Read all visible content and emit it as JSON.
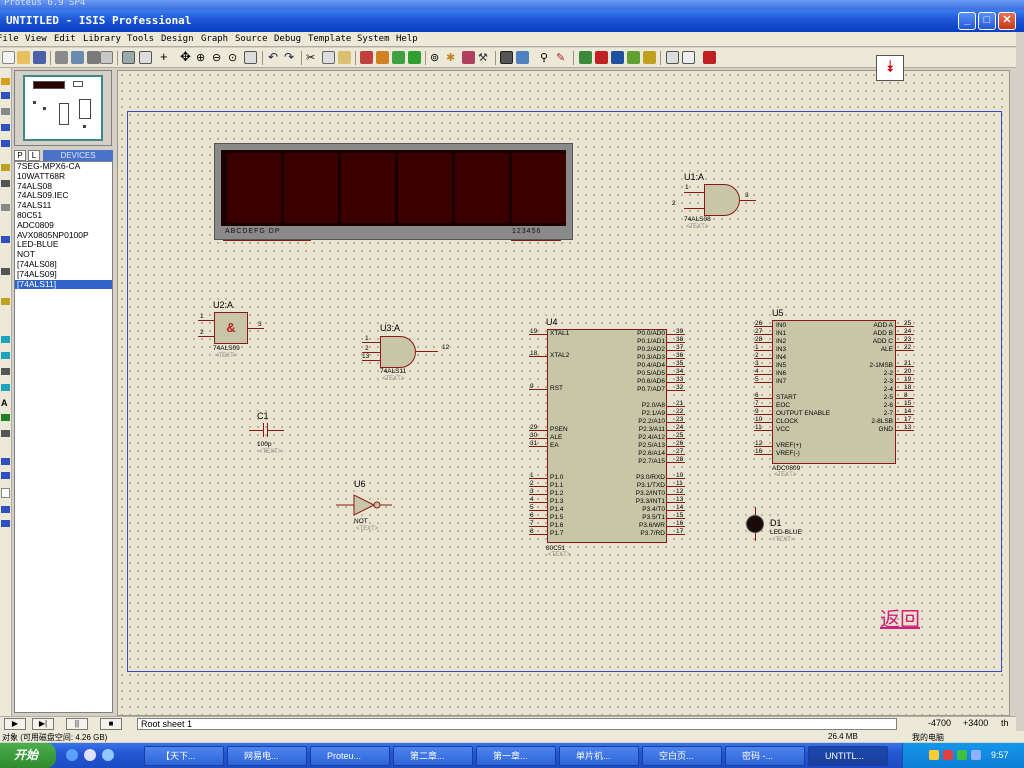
{
  "window": {
    "title": "UNTITLED - ISIS Professional",
    "ghost_title": "Proteus 6.9 SP4"
  },
  "menu": [
    "File",
    "View",
    "Edit",
    "Library",
    "Tools",
    "Design",
    "Graph",
    "Source",
    "Debug",
    "Template",
    "System",
    "Help"
  ],
  "devices": {
    "tab_p": "P",
    "tab_l": "L",
    "title": "DEVICES",
    "items": [
      "7SEG-MPX6-CA",
      "10WATT68R",
      "74ALS08",
      "74ALS09.IEC",
      "74ALS11",
      "80C51",
      "ADC0809",
      "AVX0805NP0100P",
      "LED-BLUE",
      "NOT",
      "[74ALS08]",
      "[74ALS09]",
      "[74ALS11]"
    ],
    "selected_index": 12
  },
  "canvas": {
    "back_link": "返回",
    "display": {
      "labels_left": "ABCDEFG DP",
      "labels_right": "123456"
    },
    "u1": {
      "ref": "U1:A",
      "part": "74ALS08",
      "text": "<TEXT>",
      "pins": [
        "1",
        "2",
        "3"
      ]
    },
    "u2": {
      "ref": "U2:A",
      "part": "74ALS09",
      "text": "<TEXT>",
      "symbol": "&",
      "pins": [
        "1",
        "2",
        "3"
      ]
    },
    "u3": {
      "ref": "U3:A",
      "part": "74ALS11",
      "text": "<TEXT>",
      "pins": [
        "1",
        "2",
        "13",
        "12"
      ]
    },
    "c1": {
      "ref": "C1",
      "value": "100p",
      "text": "<TEXT>"
    },
    "u6": {
      "ref": "U6",
      "part": "NOT",
      "text": "<TEXT>"
    },
    "u4": {
      "ref": "U4",
      "part": "80C51",
      "text": "<TEXT>",
      "left_pins": [
        {
          "num": "19",
          "name": "XTAL1"
        },
        {
          "num": "18",
          "name": "XTAL2"
        },
        {
          "num": "9",
          "name": "RST"
        },
        {
          "num": "29",
          "name": "PSEN"
        },
        {
          "num": "30",
          "name": "ALE"
        },
        {
          "num": "31",
          "name": "EA"
        },
        {
          "num": "1",
          "name": "P1.0"
        },
        {
          "num": "2",
          "name": "P1.1"
        },
        {
          "num": "3",
          "name": "P1.2"
        },
        {
          "num": "4",
          "name": "P1.3"
        },
        {
          "num": "5",
          "name": "P1.4"
        },
        {
          "num": "6",
          "name": "P1.5"
        },
        {
          "num": "7",
          "name": "P1.6"
        },
        {
          "num": "8",
          "name": "P1.7"
        }
      ],
      "right_pins": [
        {
          "num": "39",
          "name": "P0.0/AD0"
        },
        {
          "num": "38",
          "name": "P0.1/AD1"
        },
        {
          "num": "37",
          "name": "P0.2/AD2"
        },
        {
          "num": "36",
          "name": "P0.3/AD3"
        },
        {
          "num": "35",
          "name": "P0.4/AD4"
        },
        {
          "num": "34",
          "name": "P0.5/AD5"
        },
        {
          "num": "33",
          "name": "P0.6/AD6"
        },
        {
          "num": "32",
          "name": "P0.7/AD7"
        },
        {
          "num": "21",
          "name": "P2.0/A8"
        },
        {
          "num": "22",
          "name": "P2.1/A9"
        },
        {
          "num": "23",
          "name": "P2.2/A10"
        },
        {
          "num": "24",
          "name": "P2.3/A11"
        },
        {
          "num": "25",
          "name": "P2.4/A12"
        },
        {
          "num": "26",
          "name": "P2.5/A13"
        },
        {
          "num": "27",
          "name": "P2.6/A14"
        },
        {
          "num": "28",
          "name": "P2.7/A15"
        },
        {
          "num": "10",
          "name": "P3.0/RXD"
        },
        {
          "num": "11",
          "name": "P3.1/TXD"
        },
        {
          "num": "12",
          "name": "P3.2/INT0"
        },
        {
          "num": "13",
          "name": "P3.3/INT1"
        },
        {
          "num": "14",
          "name": "P3.4/T0"
        },
        {
          "num": "15",
          "name": "P3.5/T1"
        },
        {
          "num": "16",
          "name": "P3.6/WR"
        },
        {
          "num": "17",
          "name": "P3.7/RD"
        }
      ]
    },
    "u5": {
      "ref": "U5",
      "part": "ADC0809",
      "text": "<TEXT>",
      "left_pins": [
        {
          "num": "26",
          "name": "IN0"
        },
        {
          "num": "27",
          "name": "IN1"
        },
        {
          "num": "28",
          "name": "IN2"
        },
        {
          "num": "1",
          "name": "IN3"
        },
        {
          "num": "2",
          "name": "IN4"
        },
        {
          "num": "3",
          "name": "IN5"
        },
        {
          "num": "4",
          "name": "IN6"
        },
        {
          "num": "5",
          "name": "IN7"
        },
        {
          "num": "6",
          "name": "START"
        },
        {
          "num": "7",
          "name": "EOC"
        },
        {
          "num": "9",
          "name": "OUTPUT ENABLE"
        },
        {
          "num": "10",
          "name": "CLOCK"
        },
        {
          "num": "11",
          "name": "VCC"
        },
        {
          "num": "12",
          "name": "VREF(+)"
        },
        {
          "num": "16",
          "name": "VREF(-)"
        }
      ],
      "right_pins": [
        {
          "num": "25",
          "name": "ADD A"
        },
        {
          "num": "24",
          "name": "ADD B"
        },
        {
          "num": "23",
          "name": "ADD C"
        },
        {
          "num": "22",
          "name": "ALE"
        },
        {
          "num": "21",
          "name": "2-1MSB"
        },
        {
          "num": "20",
          "name": "2-2"
        },
        {
          "num": "19",
          "name": "2-3"
        },
        {
          "num": "18",
          "name": "2-4"
        },
        {
          "num": "8",
          "name": "2-5"
        },
        {
          "num": "15",
          "name": "2-6"
        },
        {
          "num": "14",
          "name": "2-7"
        },
        {
          "num": "17",
          "name": "2-8LSB"
        },
        {
          "num": "13",
          "name": "GND"
        }
      ]
    },
    "d1": {
      "ref": "D1",
      "part": "LED-BLUE",
      "text": "<TEXT>"
    }
  },
  "status": {
    "sheet": "Root sheet 1",
    "coord_x": "-4700",
    "coord_y": "+3400",
    "unit": "th",
    "info_left": "对象 (可用磁盘空间: 4.26 GB)",
    "info_mid": "26.4 MB",
    "info_right": "我的电脑"
  },
  "taskbar": {
    "start": "开始",
    "tasks": [
      "【天下...",
      "网易电...",
      "Proteu...",
      "第二章...",
      "第一章...",
      "单片机...",
      "空白页...",
      "密码 -...",
      "UNTITL..."
    ],
    "clock": "9:57"
  }
}
